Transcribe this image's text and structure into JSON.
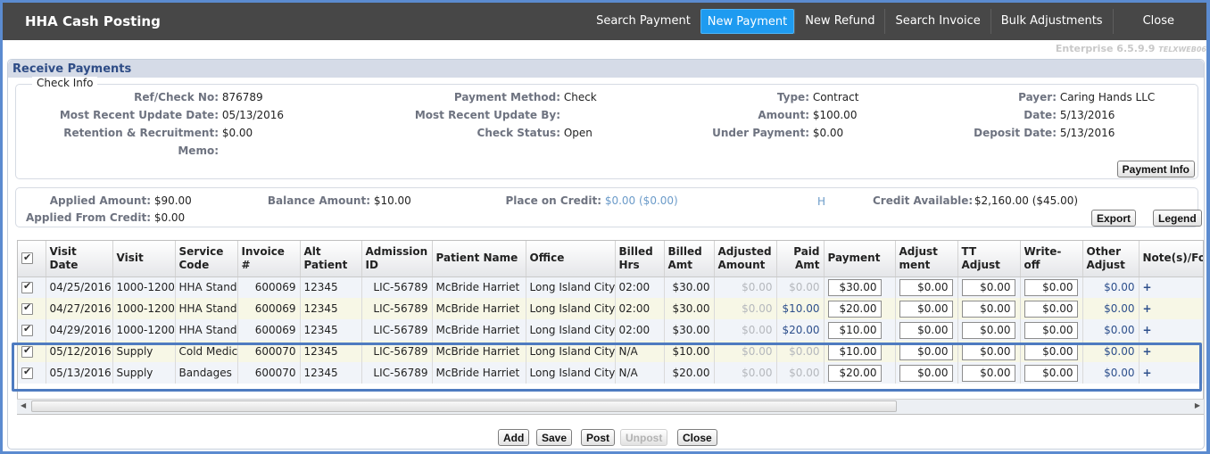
{
  "app": {
    "title": "HHA Cash Posting",
    "version": "Enterprise 6.5.9.9",
    "server": "TELXWEB06"
  },
  "nav": [
    {
      "label": "Search Payment",
      "active": false
    },
    {
      "label": "New Payment",
      "active": true
    },
    {
      "label": "New Refund",
      "active": false
    },
    {
      "label": "Search Invoice",
      "active": false
    },
    {
      "label": "Bulk Adjustments",
      "active": false
    },
    {
      "label": "Close",
      "active": false
    }
  ],
  "panel": {
    "title": "Receive Payments",
    "check_info": {
      "legend": "Check Info",
      "ref_label": "Ref/Check No:",
      "ref_value": "876789",
      "update_date_label": "Most Recent Update Date:",
      "update_date_value": "05/13/2016",
      "retention_label": "Retention & Recruitment:",
      "retention_value": "$0.00",
      "memo_label": "Memo:",
      "memo_value": "",
      "method_label": "Payment Method:",
      "method_value": "Check",
      "update_by_label": "Most Recent Update By:",
      "update_by_value": "",
      "status_label": "Check Status:",
      "status_value": "Open",
      "type_label": "Type:",
      "type_value": "Contract",
      "amount_label": "Amount:",
      "amount_value": "$100.00",
      "under_label": "Under Payment:",
      "under_value": "$0.00",
      "payer_label": "Payer:",
      "payer_value": "Caring Hands LLC",
      "date_label": "Date:",
      "date_value": "5/13/2016",
      "deposit_label": "Deposit Date:",
      "deposit_value": "5/13/2016",
      "payment_info_button": "Payment Info"
    },
    "summary": {
      "applied_label": "Applied Amount:",
      "applied_value": "$90.00",
      "from_credit_label": "Applied From Credit:",
      "from_credit_value": "$0.00",
      "balance_label": "Balance Amount:",
      "balance_value": "$10.00",
      "place_credit_label": "Place on Credit:",
      "place_credit_value": "$0.00 ($0.00)",
      "h_link": "H",
      "credit_avail_label": "Credit Available:",
      "credit_avail_value": "$2,160.00 ($45.00)",
      "export_button": "Export",
      "legend_button": "Legend"
    },
    "grid": {
      "columns": [
        "",
        "Visit Date",
        "Visit",
        "Service Code",
        "Invoice #",
        "Alt Patient",
        "Admission ID",
        "Patient Name",
        "Office",
        "Billed Hrs",
        "Billed Amt",
        "Adjusted Amount",
        "Paid Amt",
        "Payment",
        "Adjust ment",
        "TT Adjust",
        "Write- off",
        "Other Adjust",
        "Note(s)/Fo"
      ],
      "rows": [
        {
          "checked": true,
          "visit_date": "04/25/2016",
          "visit": "1000-1200",
          "service_code": "HHA Stand",
          "invoice": "600069",
          "alt_patient": "12345",
          "admission_id": "LIC-56789",
          "patient_name": "McBride Harriet",
          "office": "Long Island City",
          "billed_hrs": "02:00",
          "billed_amt": "$30.00",
          "adjusted_amount": "$0.00",
          "paid_amt": "$0.00",
          "payment": "$30.00",
          "adjustment": "$0.00",
          "tt_adjust": "$0.00",
          "write_off": "$0.00",
          "other_adjust": "$0.00",
          "notes": "+"
        },
        {
          "checked": true,
          "visit_date": "04/27/2016",
          "visit": "1000-1200",
          "service_code": "HHA Stand",
          "invoice": "600069",
          "alt_patient": "12345",
          "admission_id": "LIC-56789",
          "patient_name": "McBride Harriet",
          "office": "Long Island City",
          "billed_hrs": "02:00",
          "billed_amt": "$30.00",
          "adjusted_amount": "$0.00",
          "paid_amt": "$10.00",
          "payment": "$20.00",
          "adjustment": "$0.00",
          "tt_adjust": "$0.00",
          "write_off": "$0.00",
          "other_adjust": "$0.00",
          "notes": "+"
        },
        {
          "checked": true,
          "visit_date": "04/29/2016",
          "visit": "1000-1200",
          "service_code": "HHA Stand",
          "invoice": "600069",
          "alt_patient": "12345",
          "admission_id": "LIC-56789",
          "patient_name": "McBride Harriet",
          "office": "Long Island City",
          "billed_hrs": "02:00",
          "billed_amt": "$30.00",
          "adjusted_amount": "$0.00",
          "paid_amt": "$20.00",
          "payment": "$10.00",
          "adjustment": "$0.00",
          "tt_adjust": "$0.00",
          "write_off": "$0.00",
          "other_adjust": "$0.00",
          "notes": "+"
        },
        {
          "checked": true,
          "visit_date": "05/12/2016",
          "visit": "Supply",
          "service_code": "Cold Medici",
          "invoice": "600070",
          "alt_patient": "12345",
          "admission_id": "LIC-56789",
          "patient_name": "McBride Harriet",
          "office": "Long Island City",
          "billed_hrs": "N/A",
          "billed_amt": "$10.00",
          "adjusted_amount": "$0.00",
          "paid_amt": "$0.00",
          "payment": "$10.00",
          "adjustment": "$0.00",
          "tt_adjust": "$0.00",
          "write_off": "$0.00",
          "other_adjust": "$0.00",
          "notes": "+"
        },
        {
          "checked": true,
          "visit_date": "05/13/2016",
          "visit": "Supply",
          "service_code": "Bandages",
          "invoice": "600070",
          "alt_patient": "12345",
          "admission_id": "LIC-56789",
          "patient_name": "McBride Harriet",
          "office": "Long Island City",
          "billed_hrs": "N/A",
          "billed_amt": "$20.00",
          "adjusted_amount": "$0.00",
          "paid_amt": "$0.00",
          "payment": "$20.00",
          "adjustment": "$0.00",
          "tt_adjust": "$0.00",
          "write_off": "$0.00",
          "other_adjust": "$0.00",
          "notes": "+"
        }
      ]
    },
    "actions": {
      "add": "Add",
      "save": "Save",
      "post": "Post",
      "unpost": "Unpost",
      "close": "Close"
    }
  }
}
